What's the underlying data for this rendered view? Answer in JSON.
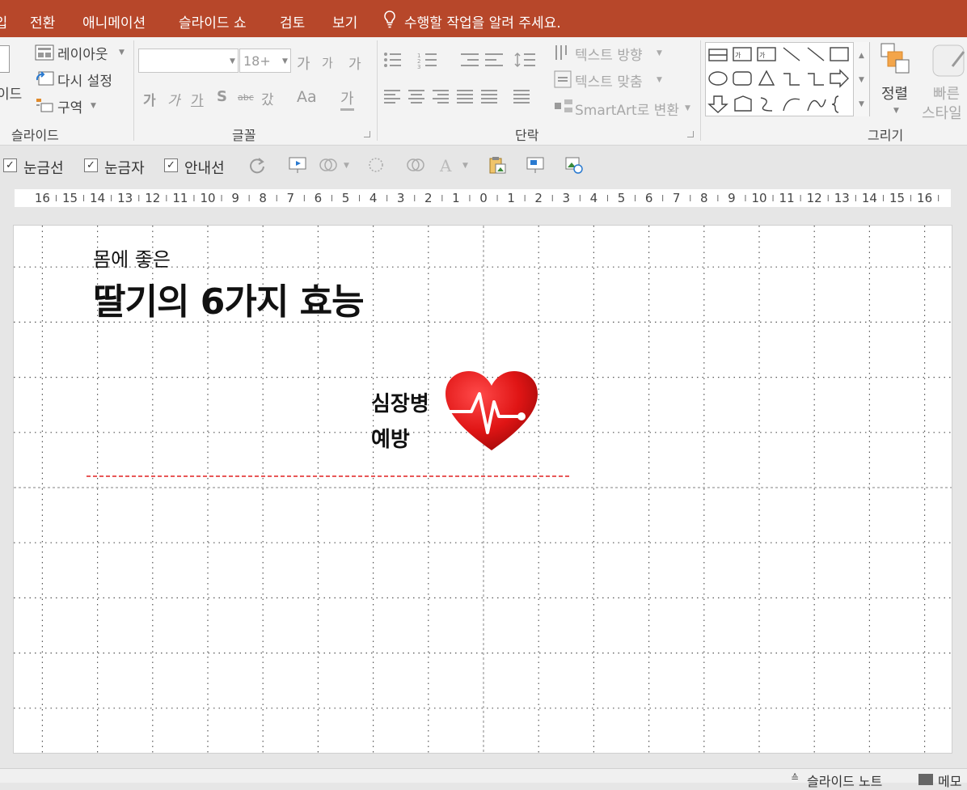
{
  "menu": {
    "cut_tab": "삽입",
    "tabs": [
      "전환",
      "애니메이션",
      "슬라이드 쇼",
      "검토",
      "보기"
    ],
    "tell_me": "수행할 작업을 알려 주세요."
  },
  "ribbon": {
    "slide_group": {
      "label": "슬라이드",
      "new_slide_partial": "이드",
      "layout": "레이아웃",
      "reset": "다시 설정",
      "section": "구역"
    },
    "font_group": {
      "label": "글꼴",
      "font_name": "",
      "font_size": "18+",
      "grow": "가",
      "shrink": "가",
      "clear": "가",
      "bold": "가",
      "italic": "가",
      "underline": "가",
      "shadow": "S",
      "strike": "abc",
      "spacing": "갔",
      "case": "Aa",
      "color": "가"
    },
    "paragraph_group": {
      "label": "단락",
      "text_direction": "텍스트 방향",
      "align_text": "텍스트 맞춤",
      "smartart": "SmartArt로 변환"
    },
    "drawing_group": {
      "label": "그리기",
      "arrange": "정렬",
      "quick_styles_1": "빠른",
      "quick_styles_2": "스타일"
    }
  },
  "quickbar": {
    "gridlines": "눈금선",
    "ruler": "눈금자",
    "guides": "안내선"
  },
  "ruler": {
    "left_labels": [
      "16",
      "15",
      "14",
      "13",
      "12",
      "11",
      "10",
      "9",
      "8",
      "7",
      "6",
      "5",
      "4",
      "3",
      "2",
      "1"
    ],
    "center_label": "0",
    "right_labels": [
      "1",
      "2",
      "3",
      "4",
      "5",
      "6",
      "7",
      "8",
      "9",
      "10",
      "11",
      "12",
      "13",
      "14",
      "15",
      "16"
    ]
  },
  "slide": {
    "subtitle": "몸에 좋은",
    "title": "딸기의 6가지 효능",
    "item_line1": "심장병",
    "item_line2": "예방",
    "heart_color": "#e01515",
    "divider_color": "#e02020"
  },
  "statusbar": {
    "notes": "슬라이드 노트",
    "comments": "메모"
  }
}
